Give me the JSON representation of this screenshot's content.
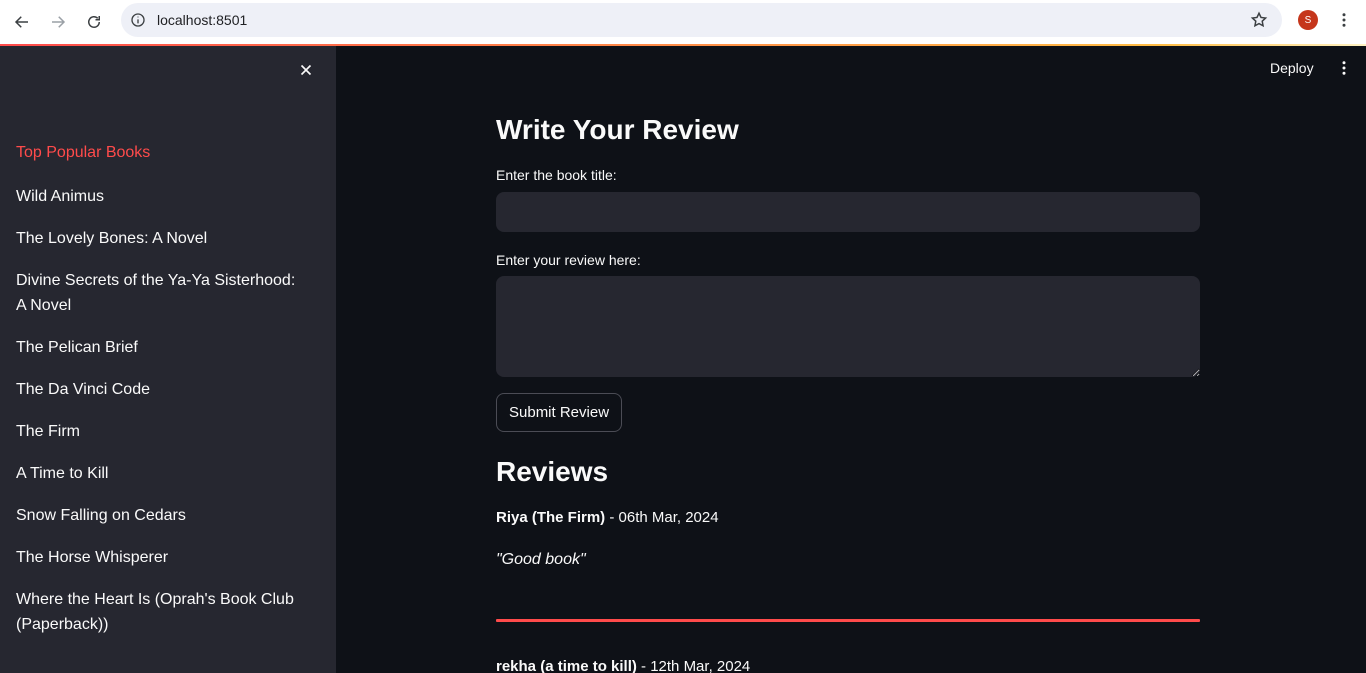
{
  "browser": {
    "url": "localhost:8501",
    "profile_initial": "S"
  },
  "sidebar": {
    "heading": "Top Popular Books",
    "books": [
      "Wild Animus",
      "The Lovely Bones: A Novel",
      "Divine Secrets of the Ya-Ya Sisterhood: A Novel",
      "The Pelican Brief",
      "The Da Vinci Code",
      "The Firm",
      "A Time to Kill",
      "Snow Falling on Cedars",
      "The Horse Whisperer",
      "Where the Heart Is (Oprah's Book Club (Paperback))"
    ]
  },
  "header": {
    "deploy_label": "Deploy"
  },
  "main": {
    "title": "Write Your Review",
    "book_title_label": "Enter the book title:",
    "book_title_value": "",
    "review_label": "Enter your review here:",
    "review_value": "",
    "submit_label": "Submit Review",
    "reviews_heading": "Reviews",
    "reviews": [
      {
        "author_book": "Riya (The Firm)",
        "date": " - 06th Mar, 2024",
        "text": "\"Good book\""
      },
      {
        "author_book": "rekha (a time to kill)",
        "date": " - 12th Mar, 2024",
        "text": ""
      }
    ]
  },
  "colors": {
    "accent": "#ff4b4b",
    "background": "#0e1117",
    "sidebar": "#262730",
    "text": "#fafafa"
  }
}
